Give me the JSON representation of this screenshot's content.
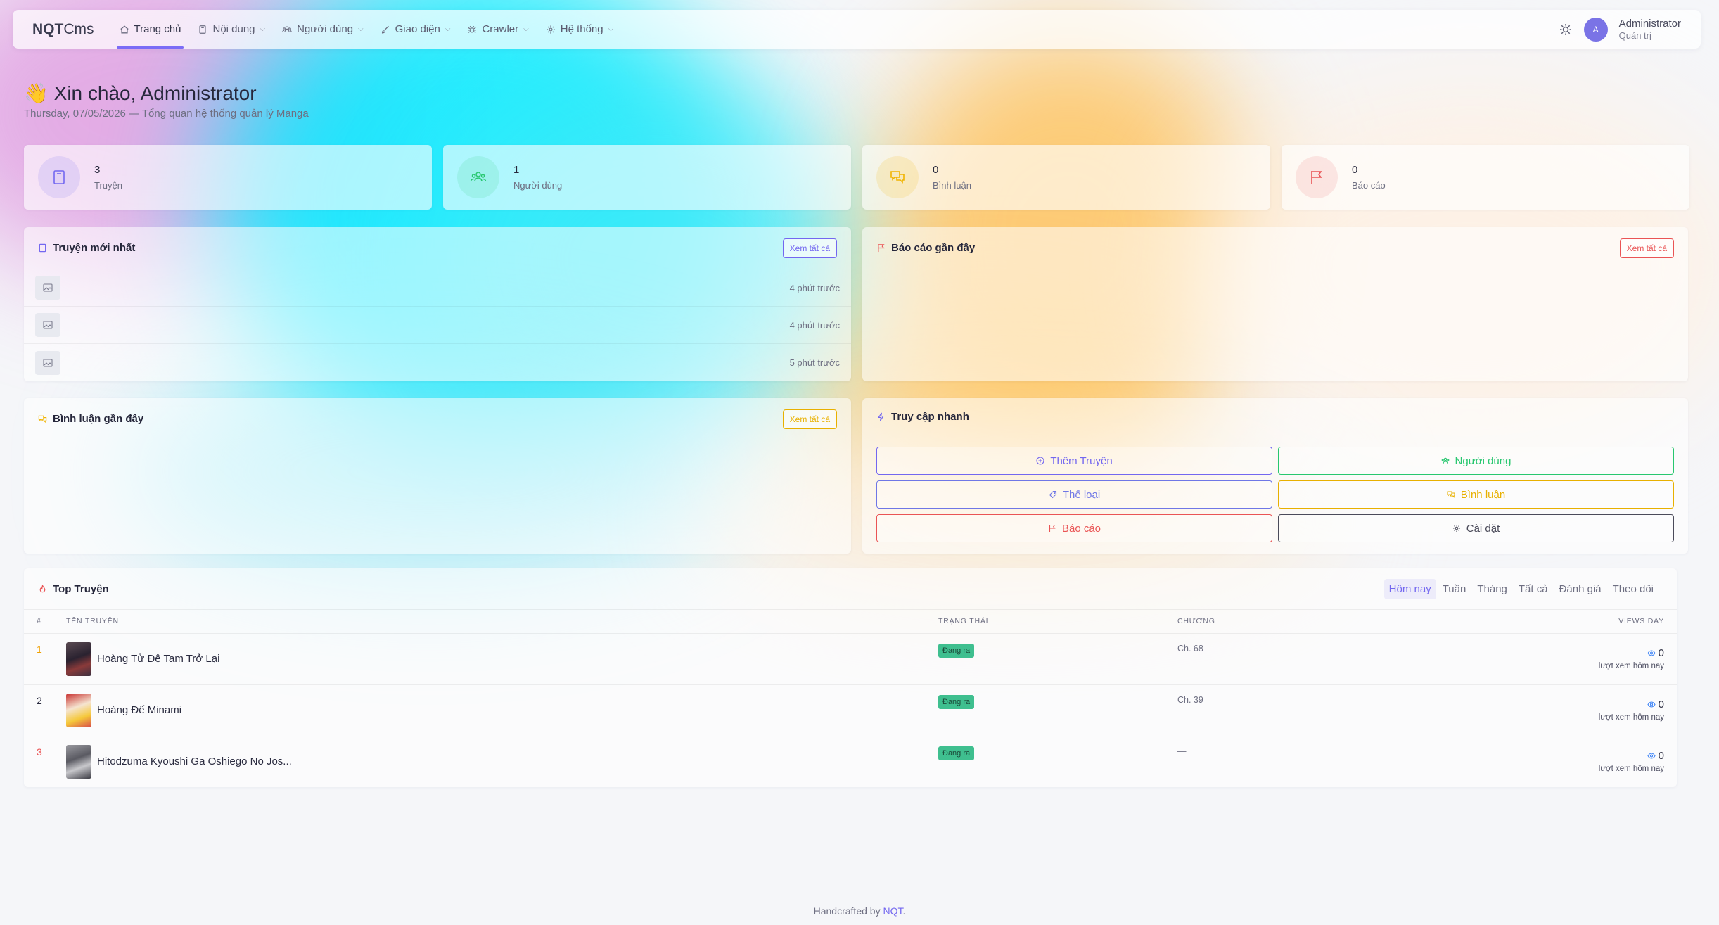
{
  "brand": {
    "bold": "NQT",
    "rest": "Cms"
  },
  "nav": {
    "items": [
      {
        "label": "Trang chủ",
        "icon": "home-icon"
      },
      {
        "label": "Nội dung",
        "icon": "book-icon"
      },
      {
        "label": "Người dùng",
        "icon": "users-icon"
      },
      {
        "label": "Giao diện",
        "icon": "brush-icon"
      },
      {
        "label": "Crawler",
        "icon": "spider-icon"
      },
      {
        "label": "Hệ thống",
        "icon": "gear-icon"
      }
    ],
    "user": {
      "initial": "A",
      "name": "Administrator",
      "role": "Quản trị"
    }
  },
  "greeting": {
    "emoji": "👋",
    "title": "Xin chào, Administrator",
    "subtitle": "Thursday, 07/05/2026 — Tổng quan hệ thống quản lý Manga"
  },
  "stats": [
    {
      "value": "3",
      "label": "Truyện",
      "icon": "book-icon",
      "color": "#7367f0"
    },
    {
      "value": "1",
      "label": "Người dùng",
      "icon": "users-icon",
      "color": "#28c76f"
    },
    {
      "value": "0",
      "label": "Bình luận",
      "icon": "comments-icon",
      "color": "#f0b400"
    },
    {
      "value": "0",
      "label": "Báo cáo",
      "icon": "flag-icon",
      "color": "#ea5455"
    }
  ],
  "latest": {
    "title": "Truyện mới nhất",
    "view_all": "Xem tất cả",
    "rows": [
      {
        "time": "4 phút trước"
      },
      {
        "time": "4 phút trước"
      },
      {
        "time": "5 phút trước"
      }
    ]
  },
  "reports": {
    "title": "Báo cáo gần đây",
    "view_all": "Xem tất cả"
  },
  "comments": {
    "title": "Bình luận gần đây",
    "view_all": "Xem tất cả"
  },
  "quick": {
    "title": "Truy cập nhanh",
    "buttons": [
      {
        "label": "Thêm Truyện",
        "color": "#7367f0"
      },
      {
        "label": "Người dùng",
        "color": "#28c76f"
      },
      {
        "label": "Thể loại",
        "color": "#6f77e6"
      },
      {
        "label": "Bình luận",
        "color": "#e8b000"
      },
      {
        "label": "Báo cáo",
        "color": "#ea5455"
      },
      {
        "label": "Cài đặt",
        "color": "#4b4b5a"
      }
    ]
  },
  "top": {
    "title": "Top Truyện",
    "tabs": [
      "Hôm nay",
      "Tuần",
      "Tháng",
      "Tất cả",
      "Đánh giá",
      "Theo dõi"
    ],
    "columns": [
      "#",
      "TÊN TRUYỆN",
      "TRẠNG THÁI",
      "CHƯƠNG",
      "VIEWS DAY"
    ],
    "rows": [
      {
        "rank": "1",
        "rank_color": "#f0a000",
        "name": "Hoàng Tử Đệ Tam Trở Lại",
        "status": "Đang ra",
        "chapter": "Ch. 68",
        "views": "0",
        "views_label": "lượt xem hôm nay"
      },
      {
        "rank": "2",
        "rank_color": "#2b2c40",
        "name": "Hoàng Đế Minami",
        "status": "Đang ra",
        "chapter": "Ch. 39",
        "views": "0",
        "views_label": "lượt xem hôm nay"
      },
      {
        "rank": "3",
        "rank_color": "#ea5455",
        "name": "Hitodzuma Kyoushi Ga Oshiego No Jos...",
        "status": "Đang ra",
        "chapter": "—",
        "views": "0",
        "views_label": "lượt xem hôm nay"
      }
    ]
  },
  "footer": {
    "text": "Handcrafted by ",
    "link": "NQT",
    "end": "."
  }
}
